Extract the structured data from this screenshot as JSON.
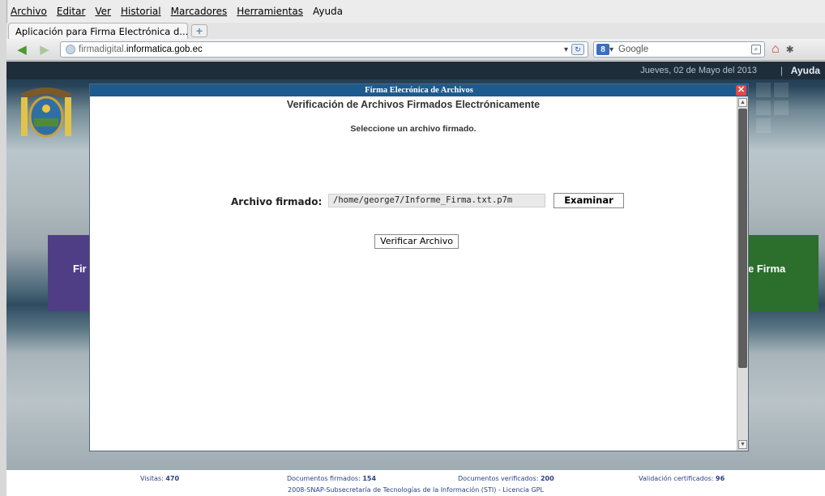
{
  "menubar": {
    "items": [
      "Archivo",
      "Editar",
      "Ver",
      "Historial",
      "Marcadores",
      "Herramientas",
      "Ayuda"
    ]
  },
  "tabs": [
    {
      "title": "Aplicación para Firma Electrónica d..."
    }
  ],
  "navbar": {
    "url_prefix": "firmadigital.",
    "url_domain": "informatica.gob.ec",
    "search_placeholder": "Google"
  },
  "site": {
    "date": "Jueves, 02 de Mayo del 2013",
    "help_sep": "|",
    "help": "Ayuda",
    "card_left_text": "Fir",
    "card_right_text": "e Firma"
  },
  "modal": {
    "title": "Firma Elecrónica de Archivos",
    "heading": "Verificación de Archivos Firmados Electrónicamente",
    "subheading": "Seleccione un archivo firmado.",
    "file_label": "Archivo firmado:",
    "file_value": "/home/george7/Informe_Firma.txt.p7m",
    "browse_label": "Examinar",
    "verify_label": "Verificar Archivo",
    "close_symbol": "✕"
  },
  "footer": {
    "visits_label": "Visitas:",
    "visits_value": "470",
    "signed_label": "Documentos firmados:",
    "signed_value": "154",
    "verified_label": "Documentos verificados:",
    "verified_value": "200",
    "certs_label": "Validación certificados:",
    "certs_value": "96",
    "license": "2008-SNAP-Subsecretaría de Tecnologías de la Información (STI) - Licencia GPL"
  },
  "colors": {
    "modal_title_bar": "#1d5a8e",
    "close_button": "#e04848",
    "card_left": "#4f3e86",
    "card_right": "#2c6e2c",
    "footer_text": "#2a3f86"
  },
  "icons": {
    "back": "back-arrow-icon",
    "forward": "forward-arrow-icon",
    "reload": "reload-icon",
    "home": "home-icon",
    "search_engine": "google-icon",
    "new_tab": "plus-icon"
  }
}
